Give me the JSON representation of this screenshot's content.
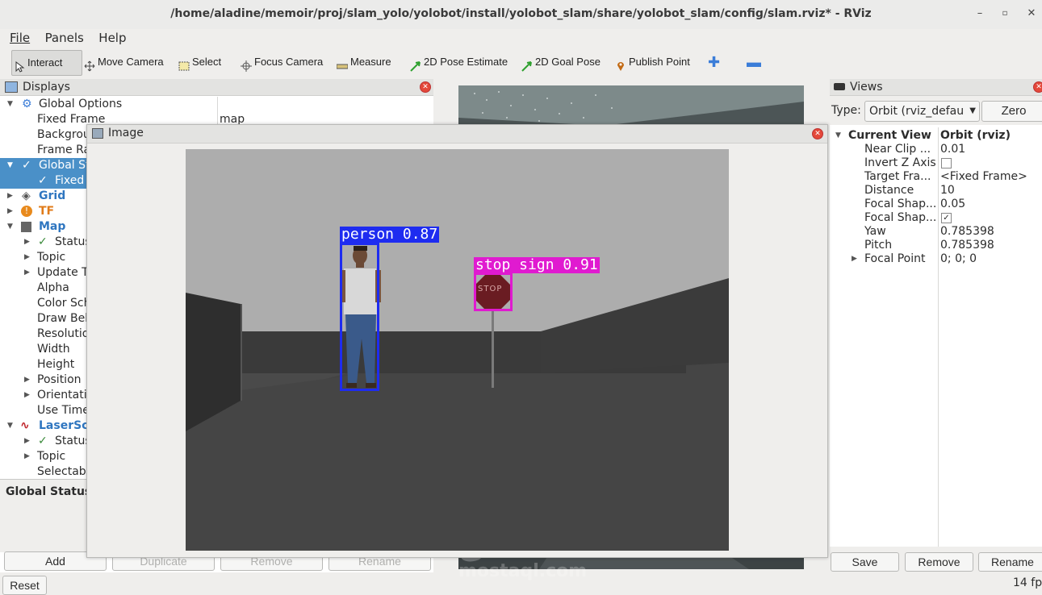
{
  "window": {
    "title": "/home/aladine/memoir/proj/slam_yolo/yolobot/install/yolobot_slam/share/yolobot_slam/config/slam.rviz* - RViz"
  },
  "menu": [
    "File",
    "Panels",
    "Help"
  ],
  "toolbar": {
    "interact": "Interact",
    "move_camera": "Move Camera",
    "select": "Select",
    "focus_camera": "Focus Camera",
    "measure": "Measure",
    "pose_estimate": "2D Pose Estimate",
    "goal_pose": "2D Goal Pose",
    "publish_point": "Publish Point"
  },
  "displays": {
    "title": "Displays",
    "global_options": "Global Options",
    "fixed_frame_label": "Fixed Frame",
    "fixed_frame_value": "map",
    "background": "Backgrou",
    "frame_rate": "Frame Ra",
    "global_status": "Global St",
    "fixed": "Fixed",
    "grid": "Grid",
    "tf": "TF",
    "map": "Map",
    "map_children": [
      "Status",
      "Topic",
      "Update T",
      "Alpha",
      "Color Sch",
      "Draw Beh",
      "Resolutio",
      "Width",
      "Height",
      "Position",
      "Orientati",
      "Use Time"
    ],
    "laserscan": "LaserSca",
    "laser_children": [
      "Status",
      "Topic",
      "Selectabl"
    ],
    "global_status_footer": "Global Status:",
    "buttons": {
      "add": "Add",
      "duplicate": "Duplicate",
      "remove": "Remove",
      "rename": "Rename"
    }
  },
  "image_panel": {
    "title": "Image",
    "detections": [
      {
        "label": "person 0.87",
        "color": "#1e2cf0"
      },
      {
        "label": "stop sign 0.91",
        "color": "#e01ad0"
      }
    ],
    "sign_text": "STOP"
  },
  "views": {
    "title": "Views",
    "type_label": "Type:",
    "type_value": "Orbit (rviz_defau",
    "zero": "Zero",
    "current_view_label": "Current View",
    "current_view_value": "Orbit (rviz)",
    "props": [
      {
        "name": "Near Clip ...",
        "value": "0.01"
      },
      {
        "name": "Invert Z Axis",
        "value": ""
      },
      {
        "name": "Target Fra...",
        "value": "<Fixed Frame>"
      },
      {
        "name": "Distance",
        "value": "10"
      },
      {
        "name": "Focal Shap...",
        "value": "0.05"
      },
      {
        "name": "Focal Shap...",
        "value": "✓"
      },
      {
        "name": "Yaw",
        "value": "0.785398"
      },
      {
        "name": "Pitch",
        "value": "0.785398"
      },
      {
        "name": "Focal Point",
        "value": "0; 0; 0"
      }
    ],
    "buttons": {
      "save": "Save",
      "remove": "Remove",
      "rename": "Rename"
    }
  },
  "status": {
    "reset": "Reset",
    "fps": "14 fp"
  },
  "watermark": {
    "arabic": "مستقل",
    "latin": "mostaql.com"
  }
}
